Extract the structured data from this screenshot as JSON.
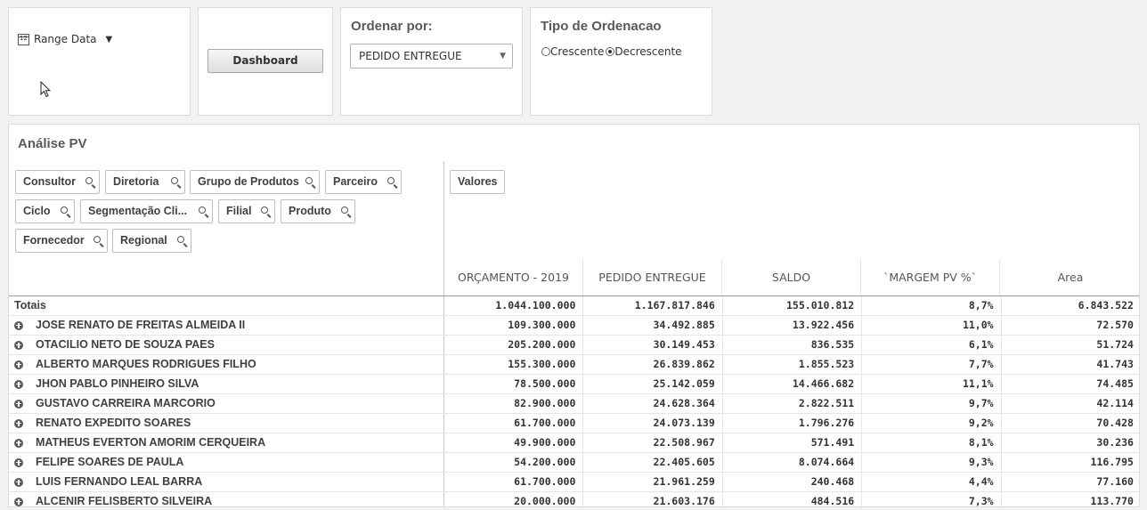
{
  "range": {
    "label": "Range Data",
    "icon": "calendar-icon"
  },
  "dashboard_button": "Dashboard",
  "order_by": {
    "title": "Ordenar por:",
    "selected": "PEDIDO ENTREGUE"
  },
  "order_type": {
    "title": "Tipo de Ordenacao",
    "options": [
      "Crescente",
      "Decrescente"
    ],
    "selected": "Decrescente"
  },
  "table": {
    "title": "Análise PV",
    "dimensions": [
      "Consultor",
      "Diretoria",
      "Grupo de Produtos",
      "Parceiro",
      "Ciclo",
      "Segmentação Cli...",
      "Filial",
      "Produto",
      "Fornecedor",
      "Regional"
    ],
    "values_chip": "Valores",
    "columns": [
      "ORÇAMENTO - 2019",
      "PEDIDO ENTREGUE",
      "SALDO",
      "`MARGEM PV %`",
      "Area"
    ],
    "totals": {
      "label": "Totais",
      "values": [
        "1.044.100.000",
        "1.167.817.846",
        "155.010.812",
        "8,7%",
        "6.843.522"
      ]
    },
    "rows": [
      {
        "name": "JOSE RENATO DE FREITAS ALMEIDA II",
        "values": [
          "109.300.000",
          "34.492.885",
          "13.922.456",
          "11,0%",
          "72.570"
        ]
      },
      {
        "name": "OTACILIO NETO DE SOUZA PAES",
        "values": [
          "205.200.000",
          "30.149.453",
          "836.535",
          "6,1%",
          "51.724"
        ]
      },
      {
        "name": "ALBERTO MARQUES RODRIGUES FILHO",
        "values": [
          "155.300.000",
          "26.839.862",
          "1.855.523",
          "7,7%",
          "41.743"
        ]
      },
      {
        "name": "JHON PABLO PINHEIRO SILVA",
        "values": [
          "78.500.000",
          "25.142.059",
          "14.466.682",
          "11,1%",
          "74.485"
        ]
      },
      {
        "name": "GUSTAVO CARREIRA MARCORIO",
        "values": [
          "82.900.000",
          "24.628.364",
          "2.822.511",
          "9,7%",
          "42.114"
        ]
      },
      {
        "name": "RENATO EXPEDITO SOARES",
        "values": [
          "61.700.000",
          "24.073.139",
          "1.796.276",
          "9,2%",
          "70.428"
        ]
      },
      {
        "name": "MATHEUS EVERTON AMORIM CERQUEIRA",
        "values": [
          "49.900.000",
          "22.508.967",
          "571.491",
          "8,1%",
          "30.236"
        ]
      },
      {
        "name": "FELIPE SOARES DE PAULA",
        "values": [
          "54.200.000",
          "22.405.605",
          "8.074.664",
          "9,3%",
          "116.795"
        ]
      },
      {
        "name": "LUIS FERNANDO LEAL BARRA",
        "values": [
          "61.700.000",
          "21.961.259",
          "240.468",
          "4,4%",
          "77.160"
        ]
      },
      {
        "name": "ALCENIR FELISBERTO SILVEIRA",
        "values": [
          "20.000.000",
          "21.603.176",
          "484.516",
          "7,3%",
          "113.770"
        ]
      }
    ]
  }
}
